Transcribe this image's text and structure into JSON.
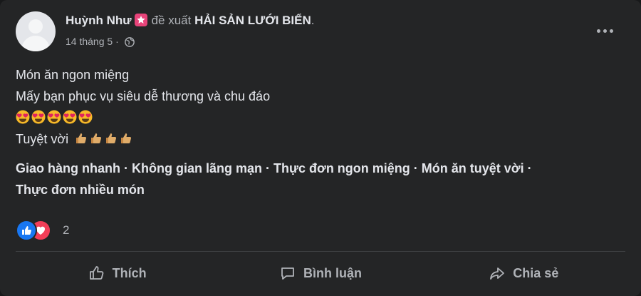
{
  "post": {
    "author": "Huỳnh Như",
    "verb": "đề xuất",
    "page": "HẢI SẢN LƯỚI BIỂN",
    "page_suffix": ".",
    "date": "14 tháng 5",
    "date_sep": "·",
    "privacy_icon": "globe-icon"
  },
  "content": {
    "line1": "Món ăn ngon miệng",
    "line2": "Mấy bạn phục vụ siêu dễ thương và chu đáo",
    "heart_eyes_count": 5,
    "line4": "Tuyệt vời",
    "thumbs_count": 4
  },
  "tags": {
    "line1": "Giao hàng nhanh · Không gian lãng mạn · Thực đơn ngon miệng · Món ăn tuyệt vời ·",
    "line2": "Thực đơn nhiều món"
  },
  "reactions": {
    "count": "2",
    "types": [
      "like-icon",
      "love-icon"
    ]
  },
  "actions": {
    "like": "Thích",
    "comment": "Bình luận",
    "share": "Chia sẻ"
  },
  "colors": {
    "background": "#242526",
    "text": "#e4e6eb",
    "secondary": "#b0b3b8",
    "like_blue": "#1877f2",
    "love_red": "#f33e58",
    "badge_pink": "#e8447a"
  }
}
